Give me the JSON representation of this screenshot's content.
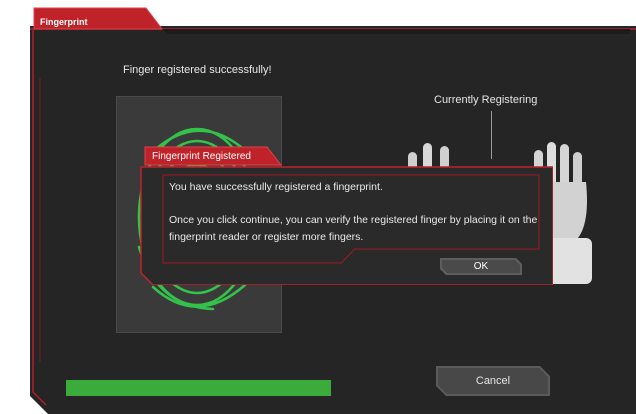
{
  "window": {
    "title": "Fingerprint",
    "status_message": "Finger registered successfully!",
    "currently_registering_label": "Currently Registering",
    "progress_fraction": 1.0,
    "cancel_label": "Cancel"
  },
  "dialog": {
    "title": "Fingerprint Registered",
    "line1": "You have successfully registered a fingerprint.",
    "line2": "Once you click continue, you can verify the registered finger by placing it on the fingerprint reader or register more fingers.",
    "ok_label": "OK"
  },
  "colors": {
    "accent_red": "#c0222a",
    "fingerprint_green": "#33c24a",
    "progress_green": "#3bab3b",
    "window_bg": "#262626"
  }
}
